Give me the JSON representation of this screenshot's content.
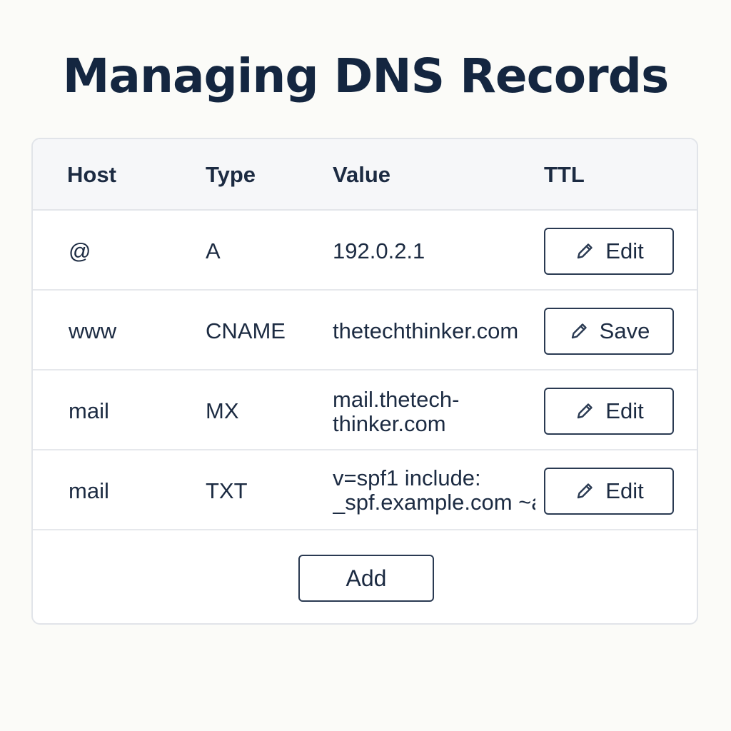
{
  "page": {
    "title": "Managing DNS Records"
  },
  "table": {
    "columns": [
      "Host",
      "Type",
      "Value",
      "TTL"
    ],
    "rows": [
      {
        "host": "@",
        "type": "A",
        "value_lines": [
          "192.0.2.1"
        ],
        "action": "Edit"
      },
      {
        "host": "www",
        "type": "CNAME",
        "value_lines": [
          "thetechthinker.com"
        ],
        "action": "Save"
      },
      {
        "host": "mail",
        "type": "MX",
        "value_lines": [
          "mail.thetech-",
          "thinker.com"
        ],
        "action": "Edit"
      },
      {
        "host": "mail",
        "type": "TXT",
        "value_lines": [
          "v=spf1 include:",
          "_spf.example.com ~all"
        ],
        "action": "Edit"
      }
    ],
    "add_label": "Add"
  },
  "icons": {
    "row_action": "pencil-icon"
  },
  "colors": {
    "background": "#fbfbf8",
    "text": "#1c2b42",
    "border": "#2a3a52",
    "header_bg": "#f6f7f9"
  }
}
